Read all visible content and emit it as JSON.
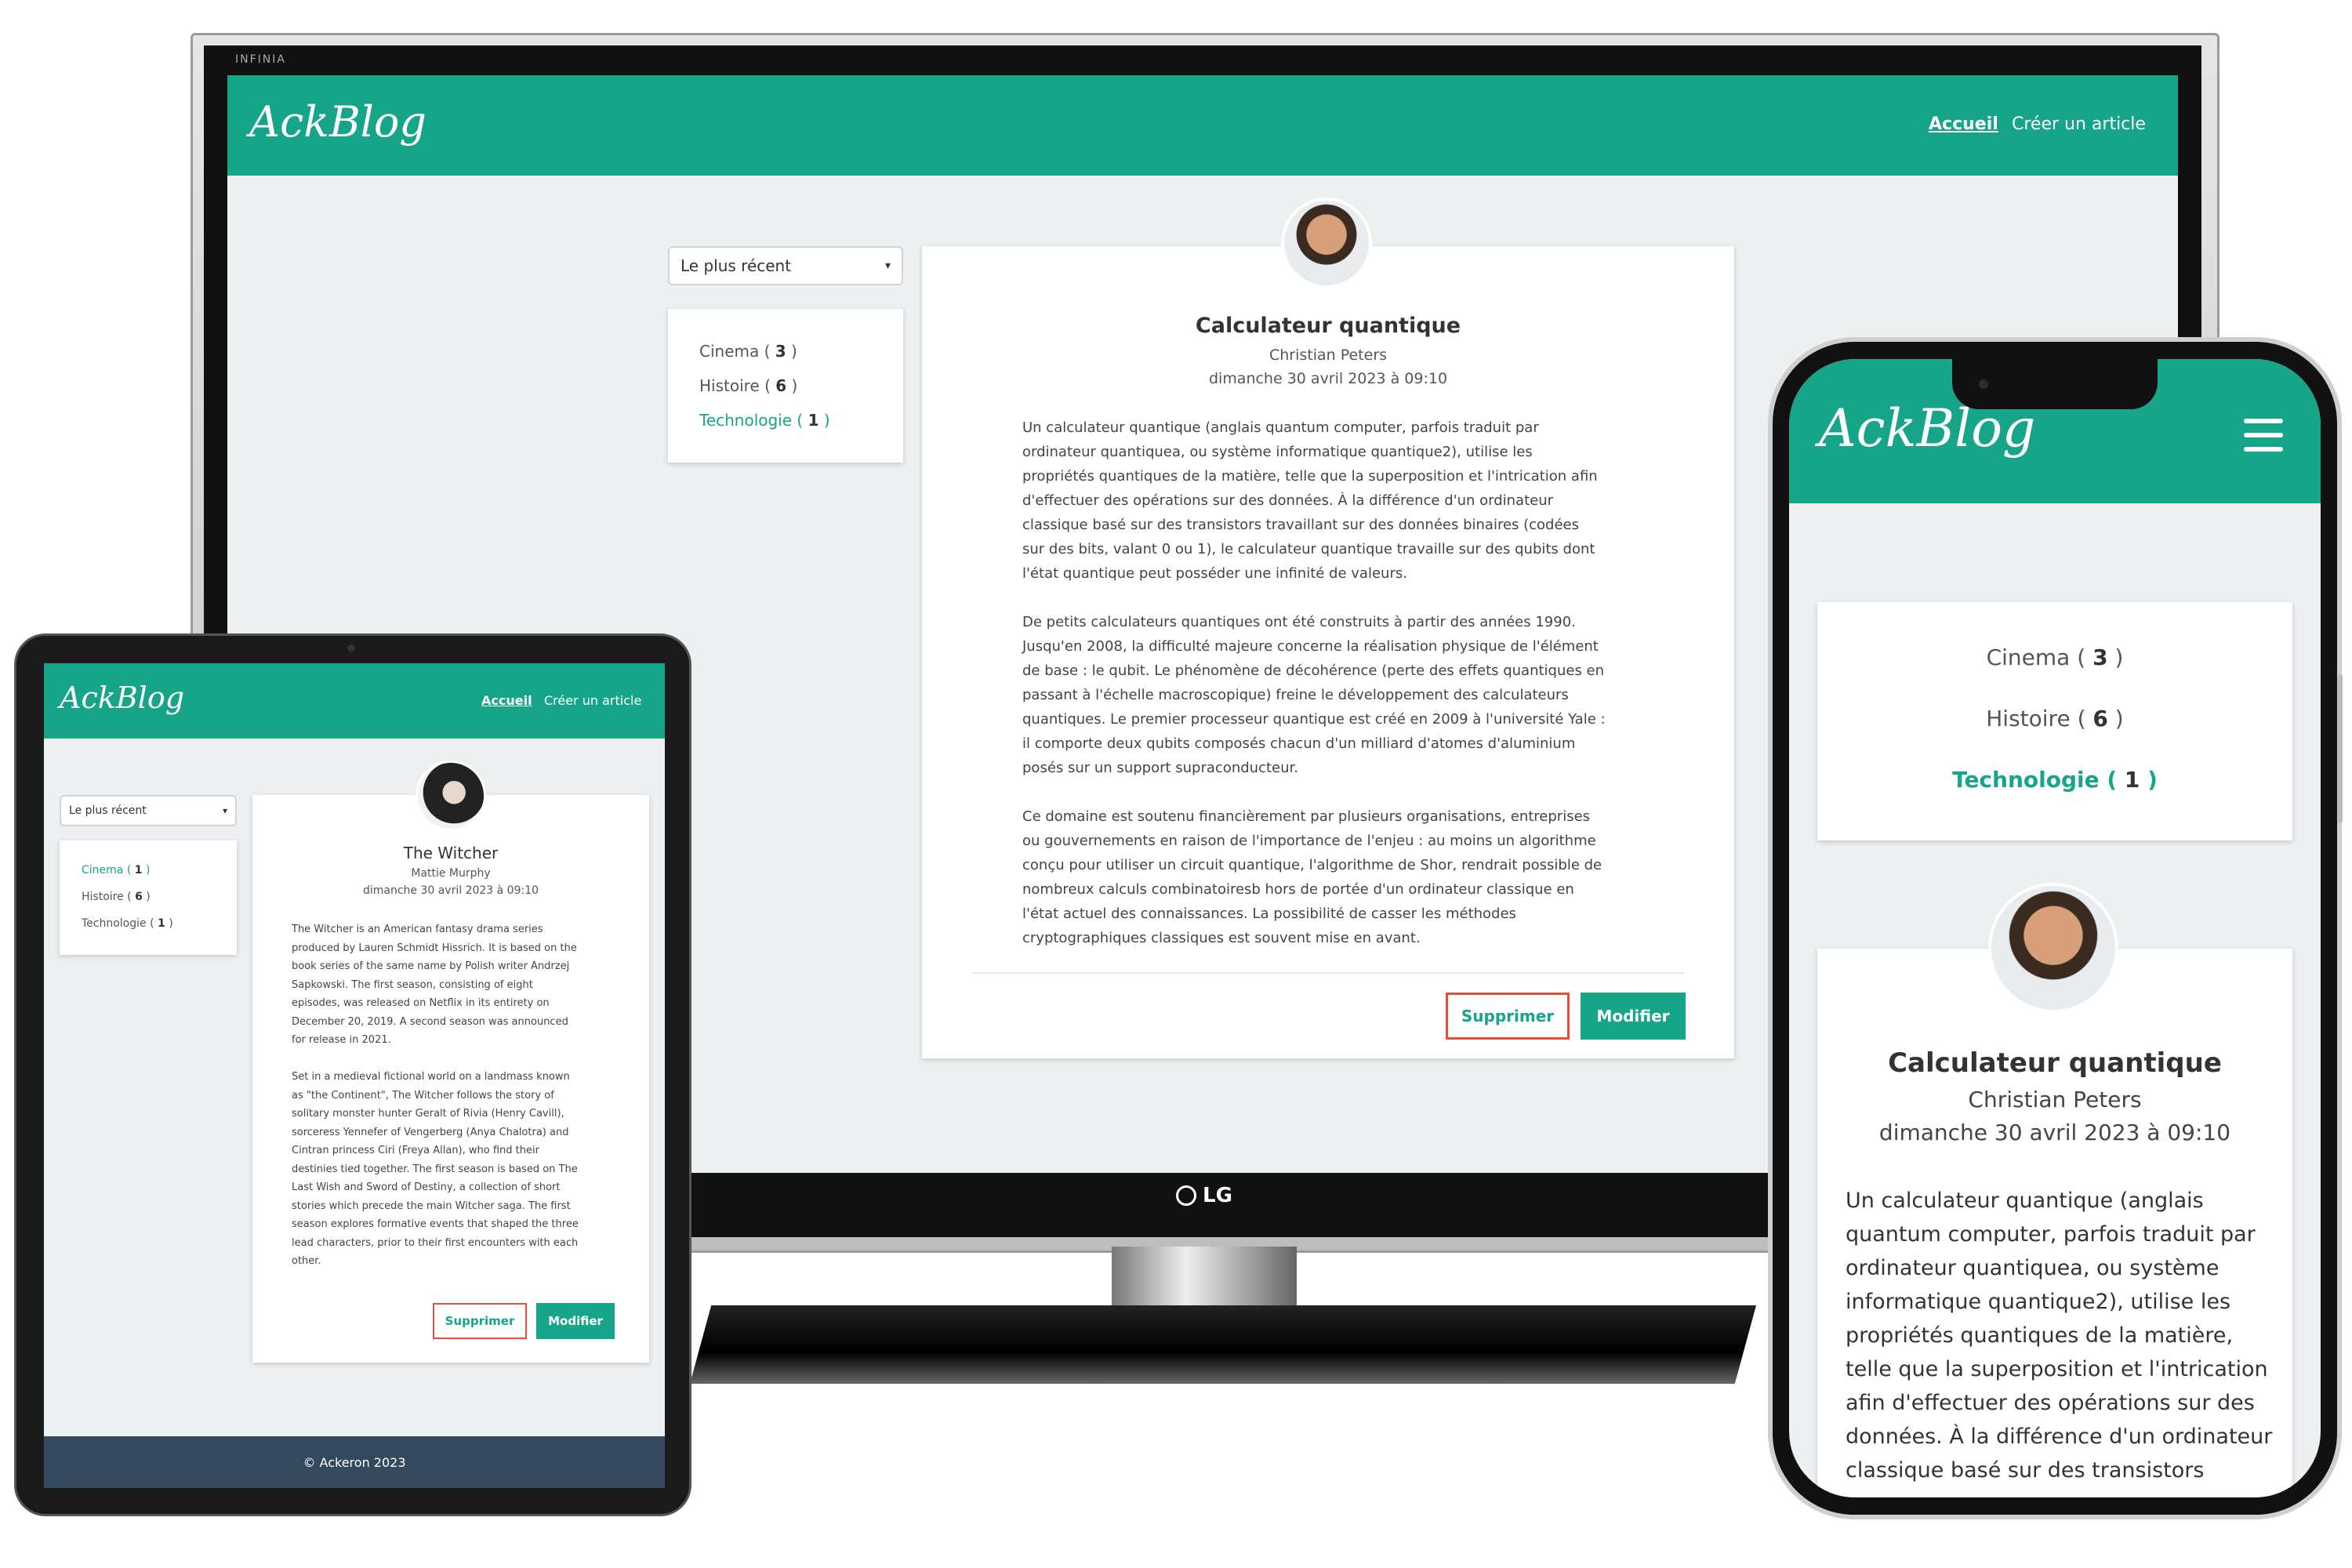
{
  "colors": {
    "accent": "#17a589",
    "danger": "#e74c3c",
    "background": "#ecf0f1",
    "footer": "#34495e"
  },
  "monitor": {
    "maker": "INFINIA",
    "logo": "LG",
    "site": {
      "brand": "AckBlog",
      "nav": [
        "Accueil",
        "Créer un article"
      ],
      "sort_select": "Le plus récent",
      "categories": [
        {
          "name": "Cinema",
          "count": "3",
          "active": false
        },
        {
          "name": "Histoire",
          "count": "6",
          "active": false
        },
        {
          "name": "Technologie",
          "count": "1",
          "active": true
        }
      ],
      "article": {
        "avatar": "avatar-photo-icon",
        "title": "Calculateur quantique",
        "author": "Christian Peters",
        "date": "dimanche 30 avril 2023 à 09:10",
        "paragraphs": [
          "Un calculateur quantique (anglais quantum computer, parfois traduit par\nordinateur quantiquea, ou système informatique quantique2), utilise les\npropriétés quantiques de la matière, telle que la superposition et l'intrication afin\nd'effectuer des opérations sur des données. À la différence d'un ordinateur\nclassique basé sur des transistors travaillant sur des données binaires (codées\nsur des bits, valant 0 ou 1), le calculateur quantique travaille sur des qubits dont\nl'état quantique peut posséder une infinité de valeurs.",
          "De petits calculateurs quantiques ont été construits à partir des années 1990.\nJusqu'en 2008, la difficulté majeure concerne la réalisation physique de l'élément\nde base : le qubit. Le phénomène de décohérence (perte des effets quantiques en\npassant à l'échelle macroscopique) freine le développement des calculateurs\nquantiques. Le premier processeur quantique est créé en 2009 à l'université Yale :\nil comporte deux qubits composés chacun d'un milliard d'atomes d'aluminium\nposés sur un support supraconducteur.",
          "Ce domaine est soutenu financièrement par plusieurs organisations, entreprises\nou gouvernements en raison de l'importance de l'enjeu : au moins un algorithme\nconçu pour utiliser un circuit quantique, l'algorithme de Shor, rendrait possible de\nnombreux calculs combinatoiresb hors de portée d'un ordinateur classique en\nl'état actuel des connaissances. La possibilité de casser les méthodes\ncryptographiques classiques est souvent mise en avant."
        ],
        "delete_label": "Supprimer",
        "edit_label": "Modifier"
      }
    }
  },
  "tablet": {
    "site": {
      "brand": "AckBlog",
      "nav": [
        "Accueil",
        "Créer un article"
      ],
      "sort_select": "Le plus récent",
      "categories": [
        {
          "name": "Cinema",
          "count": "1",
          "active": true
        },
        {
          "name": "Histoire",
          "count": "6",
          "active": false
        },
        {
          "name": "Technologie",
          "count": "1",
          "active": false
        }
      ],
      "article": {
        "avatar": "avatar-photo-icon",
        "title": "The Witcher",
        "author": "Mattie Murphy",
        "date": "dimanche 30 avril 2023 à 09:10",
        "paragraphs": [
          "The Witcher is an American fantasy drama series\nproduced by Lauren Schmidt Hissrich. It is based on the\nbook series of the same name by Polish writer Andrzej\nSapkowski. The first season, consisting of eight\nepisodes, was released on Netflix in its entirety on\nDecember 20, 2019. A second season was announced\nfor release in 2021.",
          "Set in a medieval fictional world on a landmass known\nas \"the Continent\", The Witcher follows the story of\nsolitary monster hunter Geralt of Rivia (Henry Cavill),\nsorceress Yennefer of Vengerberg (Anya Chalotra) and\nCintran princess Ciri (Freya Allan), who find their\ndestinies tied together. The first season is based on The\nLast Wish and Sword of Destiny, a collection of short\nstories which precede the main Witcher saga. The first\nseason explores formative events that shaped the three\nlead characters, prior to their first encounters with each\nother."
        ],
        "delete_label": "Supprimer",
        "edit_label": "Modifier"
      },
      "footer": "© Ackeron 2023"
    }
  },
  "phone": {
    "site": {
      "brand": "AckBlog",
      "menu_icon": "hamburger-menu-icon",
      "categories": [
        {
          "name": "Cinema",
          "count": "3",
          "active": false
        },
        {
          "name": "Histoire",
          "count": "6",
          "active": false
        },
        {
          "name": "Technologie",
          "count": "1",
          "active": true
        }
      ],
      "article": {
        "avatar": "avatar-photo-icon",
        "title": "Calculateur quantique",
        "author": "Christian Peters",
        "date": "dimanche 30 avril 2023 à 09:10",
        "excerpt": "Un calculateur quantique (anglais\nquantum computer, parfois traduit par\nordinateur quantiquea, ou système\ninformatique quantique2), utilise les\npropriétés quantiques de la matière,\ntelle que la superposition et l'intrication\nafin d'effectuer des opérations sur des\ndonnées. À la différence d'un ordinateur\nclassique basé sur des transistors"
      }
    }
  }
}
